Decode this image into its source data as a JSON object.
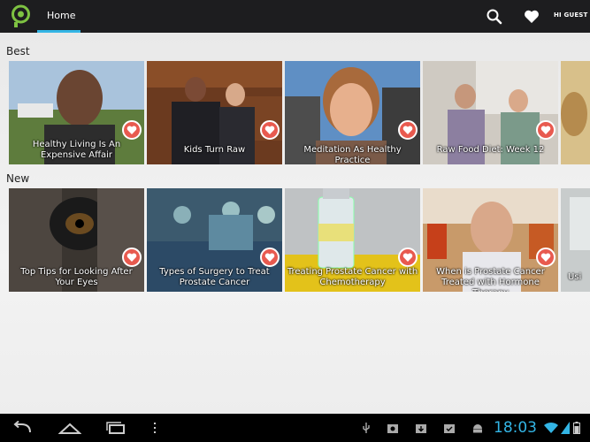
{
  "header": {
    "tab_home": "Home",
    "greeting": "HI GUEST",
    "accent_color": "#33b5e5",
    "icons": [
      "lightbulb-logo-icon",
      "search-icon",
      "heart-icon"
    ]
  },
  "sections": [
    {
      "title": "Best",
      "items": [
        {
          "caption": "Healthy Living Is An Expensive Affair"
        },
        {
          "caption": "Kids Turn Raw"
        },
        {
          "caption": "Meditation As Healthy Practice"
        },
        {
          "caption": "Raw Food Diet: Week 12"
        }
      ]
    },
    {
      "title": "New",
      "items": [
        {
          "caption": "Top Tips for Looking After Your Eyes"
        },
        {
          "caption": "Types of Surgery to Treat Prostate Cancer"
        },
        {
          "caption": "Treating Prostate Cancer with Chemotherapy"
        },
        {
          "caption": "When is Prostate Cancer Treated with Hormone Therapy"
        },
        {
          "caption": "Usi"
        }
      ]
    }
  ],
  "system_bar": {
    "time": "18:03",
    "icons": [
      "back-icon",
      "home-icon",
      "recent-apps-icon",
      "menu-icon",
      "usb-icon",
      "camera-icon",
      "download-icon",
      "download-done-icon",
      "android-debug-icon",
      "wifi-icon",
      "battery-icon"
    ]
  }
}
